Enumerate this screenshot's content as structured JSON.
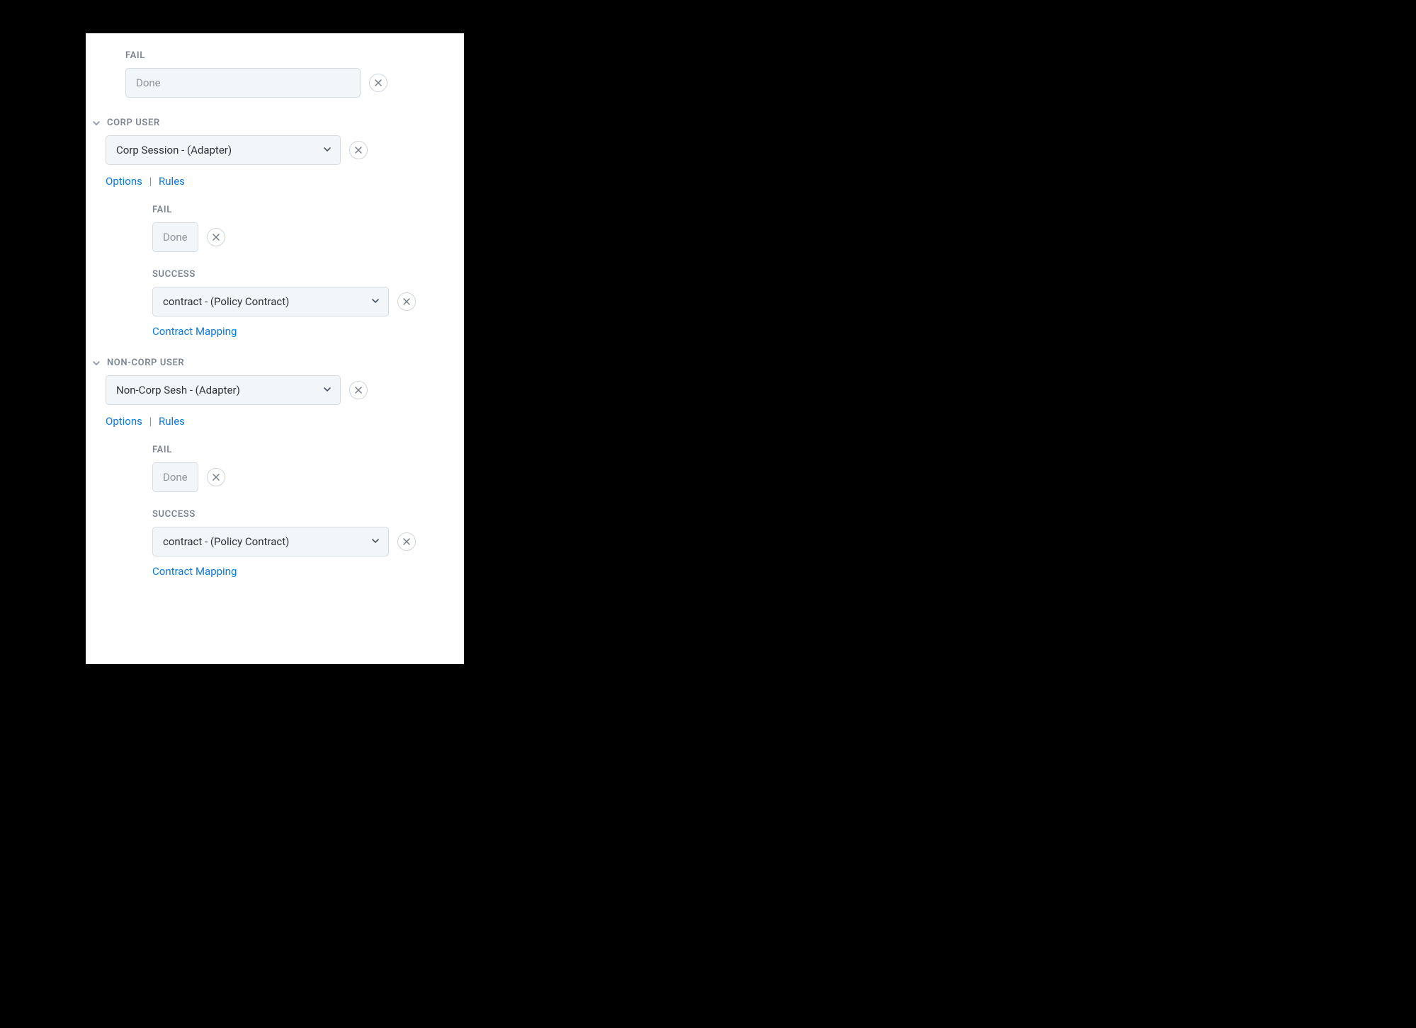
{
  "top_fail": {
    "label": "FAIL",
    "value": "Done"
  },
  "sections": [
    {
      "title": "CORP USER",
      "adapter": "Corp Session - (Adapter)",
      "options_label": "Options",
      "rules_label": "Rules",
      "fail": {
        "label": "FAIL",
        "value": "Done"
      },
      "success": {
        "label": "SUCCESS",
        "value": "contract - (Policy Contract)",
        "mapping_label": "Contract Mapping"
      }
    },
    {
      "title": "NON-CORP USER",
      "adapter": "Non-Corp Sesh - (Adapter)",
      "options_label": "Options",
      "rules_label": "Rules",
      "fail": {
        "label": "FAIL",
        "value": "Done"
      },
      "success": {
        "label": "SUCCESS",
        "value": "contract - (Policy Contract)",
        "mapping_label": "Contract Mapping"
      }
    }
  ]
}
